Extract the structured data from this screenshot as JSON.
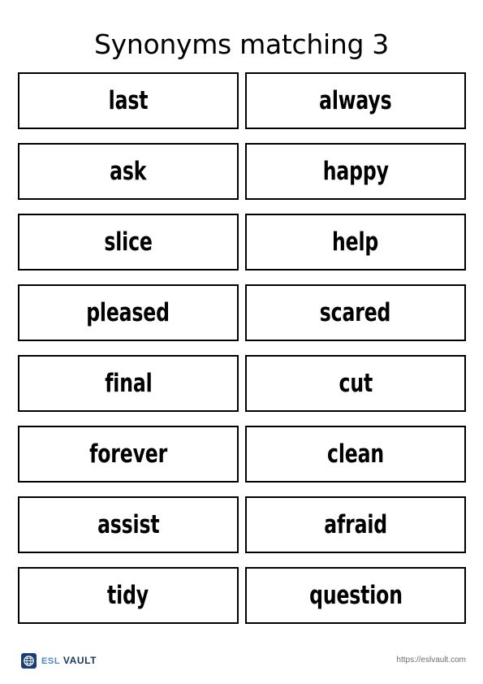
{
  "page": {
    "title": "Synonyms matching 3",
    "background_color": "#ffffff",
    "text_color": "#000000"
  },
  "cards": {
    "border_color": "#000000",
    "rows": [
      {
        "left": "last",
        "right": "always"
      },
      {
        "left": "ask",
        "right": "happy"
      },
      {
        "left": "slice",
        "right": "help"
      },
      {
        "left": "pleased",
        "right": "scared"
      },
      {
        "left": "final",
        "right": "cut"
      },
      {
        "left": "forever",
        "right": "clean"
      },
      {
        "left": "assist",
        "right": "afraid"
      },
      {
        "left": "tidy",
        "right": "question"
      }
    ]
  },
  "footer": {
    "brand_icon": "globe-logo-icon",
    "brand_name_first": "ESL",
    "brand_name_second": "Vault",
    "brand_color_first": "#4f86c6",
    "brand_color_second": "#16355e",
    "brand_mark_color": "#1b3f73",
    "url": "https://eslvault.com",
    "url_color": "#6e6e6e"
  }
}
